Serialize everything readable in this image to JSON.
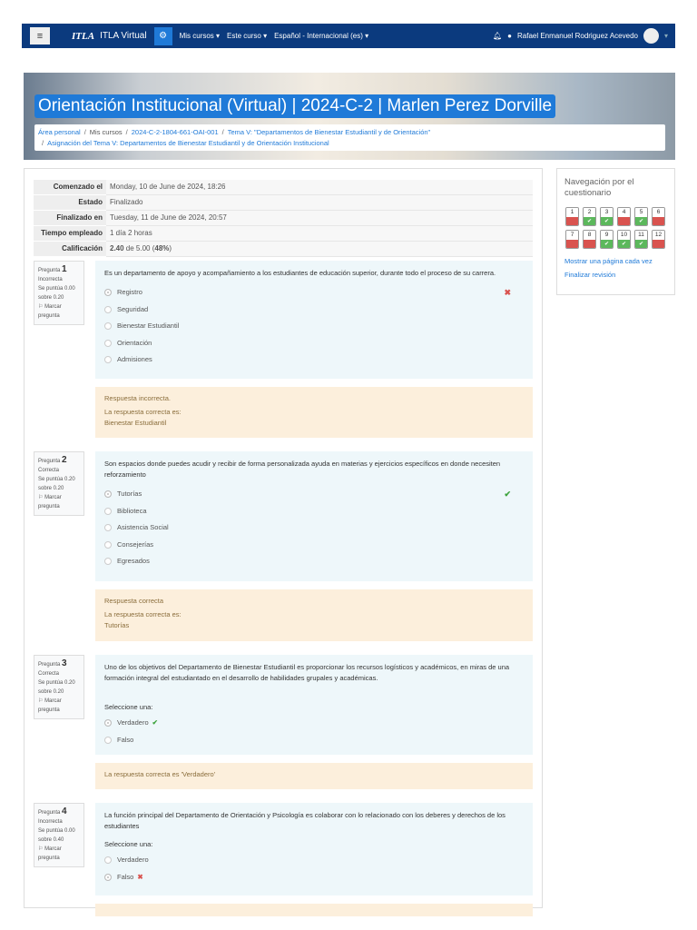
{
  "nav": {
    "site": "ITLA Virtual",
    "logo": "ITLA",
    "menu": [
      "Mis cursos ▾",
      "Este curso ▾",
      "Español - Internacional (es) ▾"
    ],
    "user": "Rafael Enmanuel Rodriguez Acevedo"
  },
  "header": {
    "title": "Orientación Institucional (Virtual) | 2024-C-2 | Marlen Perez Dorville",
    "breadcrumbs": [
      "Área personal",
      "Mis cursos",
      "2024-C-2-1804-661-OAI-001",
      "Tema V: \"Departamentos de Bienestar Estudiantil y de Orientación\"",
      "Asignación del Tema V: Departamentos de Bienestar Estudiantil y de Orientación Institucional"
    ]
  },
  "summary": {
    "rows": [
      {
        "label": "Comenzado el",
        "value": "Monday, 10 de June de 2024, 18:26"
      },
      {
        "label": "Estado",
        "value": "Finalizado"
      },
      {
        "label": "Finalizado en",
        "value": "Tuesday, 11 de June de 2024, 20:57"
      },
      {
        "label": "Tiempo empleado",
        "value": "1 día 2 horas"
      },
      {
        "label": "Calificación",
        "score": "2.40",
        "rest": " de 5.00 (",
        "pct": "48%",
        "end": ")"
      }
    ]
  },
  "questions": [
    {
      "label": "Pregunta",
      "num": "1",
      "state": "Incorrecta",
      "score": "Se puntúa 0.00 sobre 0.20",
      "flag": "Marcar pregunta",
      "text": "Es un departamento de apoyo y acompañamiento a los estudiantes de educación superior, durante todo el proceso de su carrera.",
      "options": [
        "Registro",
        "Seguridad",
        "Bienestar Estudiantil",
        "Orientación",
        "Admisiones"
      ],
      "fb1": "Respuesta incorrecta.",
      "fb2": "La respuesta correcta es:",
      "fb3": "Bienestar Estudiantil"
    },
    {
      "label": "Pregunta",
      "num": "2",
      "state": "Correcta",
      "score": "Se puntúa 0.20 sobre 0.20",
      "flag": "Marcar pregunta",
      "text": "Son espacios donde puedes acudir y recibir de forma personalizada ayuda en materias y ejercicios específicos en donde necesiten reforzamiento",
      "options": [
        "Tutorías",
        "Biblioteca",
        "Asistencia Social",
        "Consejerías",
        "Egresados"
      ],
      "fb1": "Respuesta correcta",
      "fb2": "La respuesta correcta es:",
      "fb3": "Tutorías"
    },
    {
      "label": "Pregunta",
      "num": "3",
      "state": "Correcta",
      "score": "Se puntúa 0.20 sobre 0.20",
      "flag": "Marcar pregunta",
      "text": "Uno de los objetivos del Departamento de Bienestar Estudiantil es proporcionar los recursos logísticos y académicos, en miras de una formación integral del estudiantado en el desarrollo de habilidades grupales y académicas.",
      "prompt": "Seleccione una:",
      "options": [
        "Verdadero",
        "Falso"
      ],
      "fb1": "La respuesta correcta es 'Verdadero'"
    },
    {
      "label": "Pregunta",
      "num": "4",
      "state": "Incorrecta",
      "score": "Se puntúa 0.00 sobre 0.40",
      "flag": "Marcar pregunta",
      "text": "La función principal del Departamento de Orientación y Psicología es colaborar con lo relacionado con los deberes y derechos de los estudiantes",
      "prompt": "Seleccione una:",
      "options": [
        "Verdadero",
        "Falso"
      ]
    }
  ],
  "sidebar": {
    "title": "Navegación por el cuestionario",
    "cells": [
      {
        "n": "1",
        "s": "incorrect"
      },
      {
        "n": "2",
        "s": "correct"
      },
      {
        "n": "3",
        "s": "correct"
      },
      {
        "n": "4",
        "s": "incorrect"
      },
      {
        "n": "5",
        "s": "correct"
      },
      {
        "n": "6",
        "s": "incorrect"
      },
      {
        "n": "7",
        "s": "incorrect"
      },
      {
        "n": "8",
        "s": "incorrect"
      },
      {
        "n": "9",
        "s": "correct"
      },
      {
        "n": "10",
        "s": "correct"
      },
      {
        "n": "11",
        "s": "correct"
      },
      {
        "n": "12",
        "s": "incorrect"
      }
    ],
    "link1": "Mostrar una página cada vez",
    "link2": "Finalizar revisión"
  },
  "colors": {
    "navbar": "#0b3a7e",
    "accent": "#1f7ad8",
    "correct": "#5cb85c",
    "incorrect": "#d9534f"
  }
}
